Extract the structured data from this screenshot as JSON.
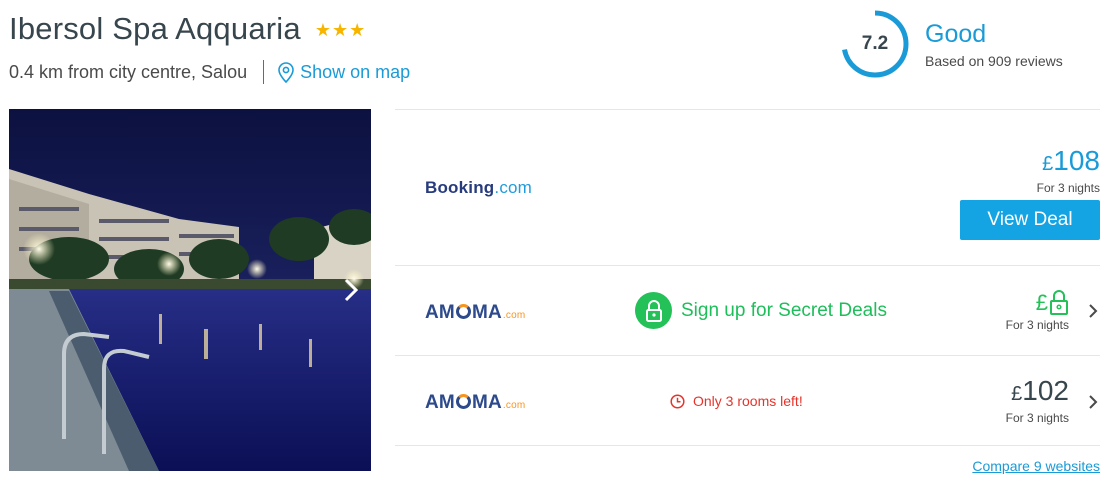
{
  "hotel": {
    "name": "Ibersol Spa Aqquaria",
    "stars": 3,
    "distance": "0.4 km from city centre, Salou",
    "map_link": "Show on map"
  },
  "rating": {
    "score": "7.2",
    "score_fraction": 0.72,
    "label": "Good",
    "reviews": "Based on 909 reviews",
    "ring_color": "#1a9bd7"
  },
  "photo": {
    "next_icon": "chevron-right-icon"
  },
  "deals": [
    {
      "provider": "Booking",
      "provider_suffix": ".com",
      "currency": "£",
      "price": "108",
      "nights": "For 3 nights",
      "button_label": "View Deal"
    },
    {
      "provider": "AM",
      "provider_mid": "MA",
      "provider_suffix": ".com",
      "secret_label": "Sign up for Secret Deals",
      "currency": "£",
      "nights": "For 3 nights"
    },
    {
      "provider": "AM",
      "provider_mid": "MA",
      "provider_suffix": ".com",
      "scarcity": "Only 3 rooms left!",
      "currency": "£",
      "price": "102",
      "nights": "For 3 nights"
    }
  ],
  "compare_link": "Compare 9 websites",
  "colors": {
    "accent": "#1a9bd7",
    "secret_green": "#24c058",
    "alert_red": "#e5332a",
    "star_gold": "#f7b500"
  }
}
